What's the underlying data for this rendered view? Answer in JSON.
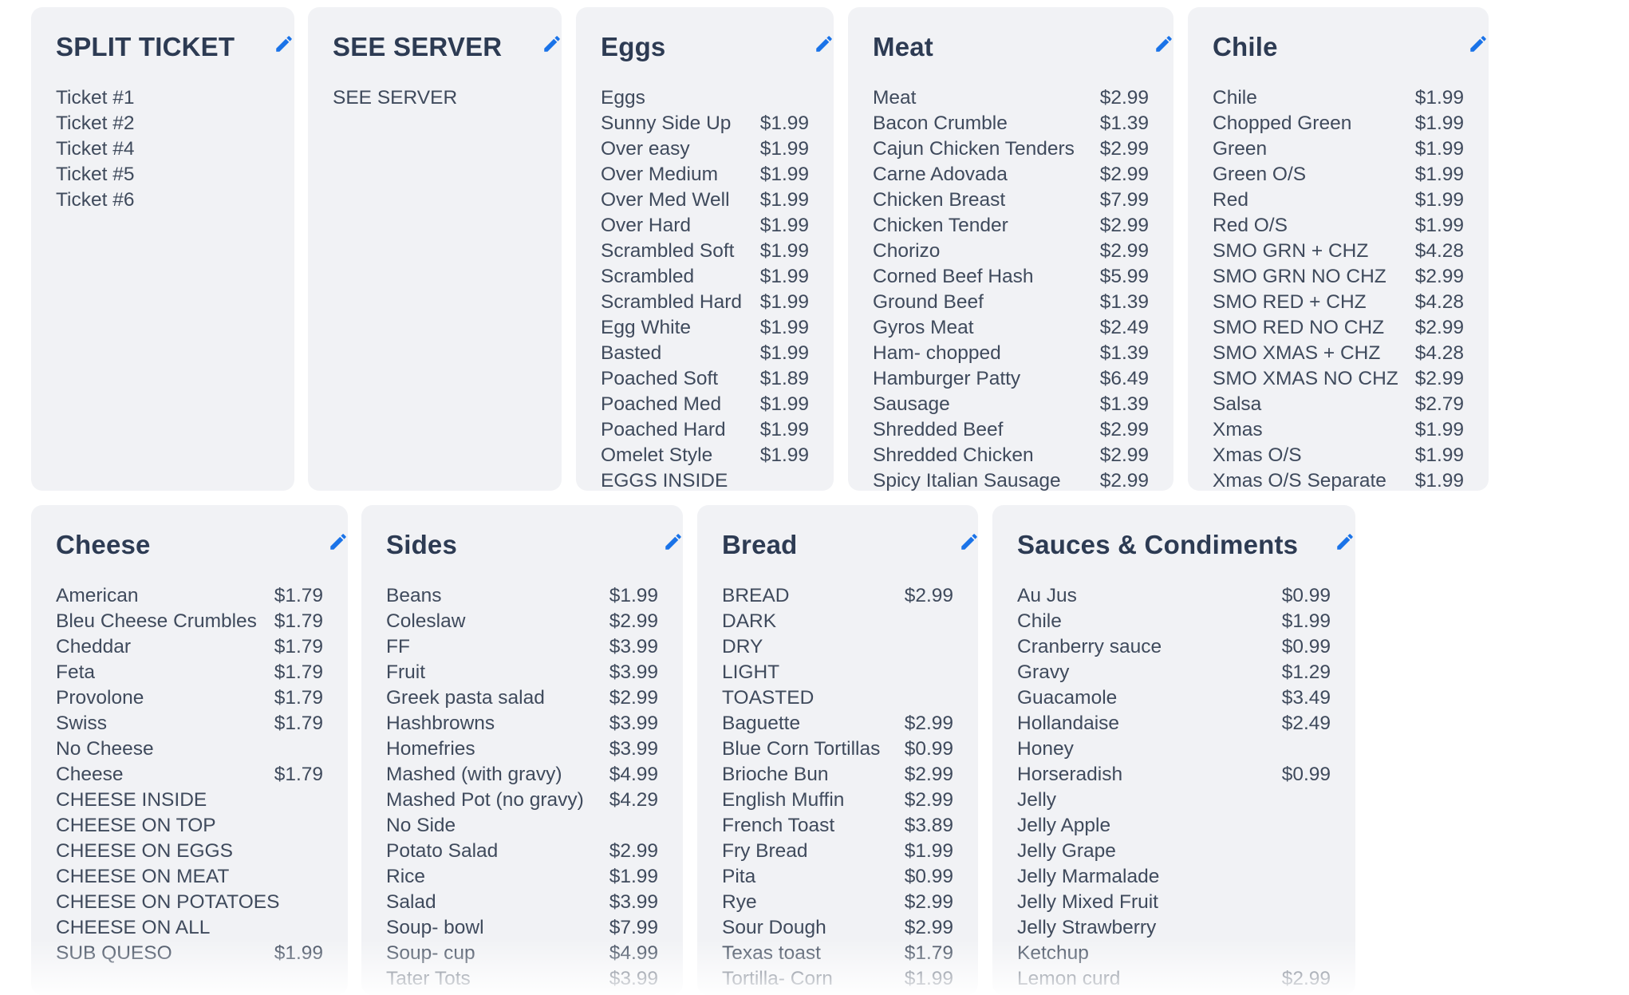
{
  "accent_color": "#1a73e8",
  "cards": [
    {
      "key": "split",
      "title": "SPLIT TICKET",
      "items": [
        {
          "n": "Ticket #1",
          "p": ""
        },
        {
          "n": "Ticket #2",
          "p": ""
        },
        {
          "n": "Ticket #4",
          "p": ""
        },
        {
          "n": "Ticket #5",
          "p": ""
        },
        {
          "n": "Ticket #6",
          "p": ""
        }
      ]
    },
    {
      "key": "server",
      "title": "SEE SERVER",
      "items": [
        {
          "n": "SEE SERVER",
          "p": ""
        }
      ]
    },
    {
      "key": "eggs",
      "title": "Eggs",
      "items": [
        {
          "n": "Eggs",
          "p": ""
        },
        {
          "n": "Sunny Side Up",
          "p": "$1.99"
        },
        {
          "n": "Over easy",
          "p": "$1.99"
        },
        {
          "n": "Over Medium",
          "p": "$1.99"
        },
        {
          "n": "Over Med Well",
          "p": "$1.99"
        },
        {
          "n": "Over Hard",
          "p": "$1.99"
        },
        {
          "n": "Scrambled Soft",
          "p": "$1.99"
        },
        {
          "n": "Scrambled",
          "p": "$1.99"
        },
        {
          "n": "Scrambled Hard",
          "p": "$1.99"
        },
        {
          "n": "Egg White",
          "p": "$1.99"
        },
        {
          "n": "Basted",
          "p": "$1.99"
        },
        {
          "n": "Poached Soft",
          "p": "$1.89"
        },
        {
          "n": "Poached Med",
          "p": "$1.99"
        },
        {
          "n": "Poached Hard",
          "p": "$1.99"
        },
        {
          "n": "Omelet Style",
          "p": "$1.99"
        },
        {
          "n": "EGGS INSIDE",
          "p": ""
        }
      ]
    },
    {
      "key": "meat",
      "title": "Meat",
      "items": [
        {
          "n": "Meat",
          "p": "$2.99"
        },
        {
          "n": "Bacon Crumble",
          "p": "$1.39"
        },
        {
          "n": "Cajun Chicken Tenders",
          "p": "$2.99"
        },
        {
          "n": "Carne Adovada",
          "p": "$2.99"
        },
        {
          "n": "Chicken Breast",
          "p": "$7.99"
        },
        {
          "n": "Chicken Tender",
          "p": "$2.99"
        },
        {
          "n": "Chorizo",
          "p": "$2.99"
        },
        {
          "n": "Corned Beef Hash",
          "p": "$5.99"
        },
        {
          "n": "Ground Beef",
          "p": "$1.39"
        },
        {
          "n": "Gyros Meat",
          "p": "$2.49"
        },
        {
          "n": "Ham- chopped",
          "p": "$1.39"
        },
        {
          "n": "Hamburger Patty",
          "p": "$6.49"
        },
        {
          "n": "Sausage",
          "p": "$1.39"
        },
        {
          "n": "Shredded Beef",
          "p": "$2.99"
        },
        {
          "n": "Shredded Chicken",
          "p": "$2.99"
        },
        {
          "n": "Spicy Italian Sausage",
          "p": "$2.99"
        }
      ]
    },
    {
      "key": "chile",
      "title": "Chile",
      "items": [
        {
          "n": "Chile",
          "p": "$1.99"
        },
        {
          "n": "Chopped Green",
          "p": "$1.99"
        },
        {
          "n": "Green",
          "p": "$1.99"
        },
        {
          "n": "Green O/S",
          "p": "$1.99"
        },
        {
          "n": "Red",
          "p": "$1.99"
        },
        {
          "n": "Red O/S",
          "p": "$1.99"
        },
        {
          "n": "SMO GRN + CHZ",
          "p": "$4.28"
        },
        {
          "n": "SMO GRN NO CHZ",
          "p": "$2.99"
        },
        {
          "n": "SMO RED + CHZ",
          "p": "$4.28"
        },
        {
          "n": "SMO RED NO CHZ",
          "p": "$2.99"
        },
        {
          "n": "SMO XMAS + CHZ",
          "p": "$4.28"
        },
        {
          "n": "SMO XMAS NO CHZ",
          "p": "$2.99"
        },
        {
          "n": "Salsa",
          "p": "$2.79"
        },
        {
          "n": "Xmas",
          "p": "$1.99"
        },
        {
          "n": "Xmas O/S",
          "p": "$1.99"
        },
        {
          "n": "Xmas O/S Separate",
          "p": "$1.99"
        }
      ]
    },
    {
      "key": "cheese",
      "title": "Cheese",
      "items": [
        {
          "n": "American",
          "p": "$1.79"
        },
        {
          "n": "Bleu Cheese Crumbles",
          "p": "$1.79"
        },
        {
          "n": "Cheddar",
          "p": "$1.79"
        },
        {
          "n": "Feta",
          "p": "$1.79"
        },
        {
          "n": "Provolone",
          "p": "$1.79"
        },
        {
          "n": "Swiss",
          "p": "$1.79"
        },
        {
          "n": "No Cheese",
          "p": ""
        },
        {
          "n": "Cheese",
          "p": "$1.79"
        },
        {
          "n": "CHEESE INSIDE",
          "p": ""
        },
        {
          "n": "CHEESE ON TOP",
          "p": ""
        },
        {
          "n": "CHEESE ON EGGS",
          "p": ""
        },
        {
          "n": "CHEESE ON MEAT",
          "p": ""
        },
        {
          "n": "CHEESE ON POTATOES",
          "p": ""
        },
        {
          "n": "CHEESE ON ALL",
          "p": ""
        },
        {
          "n": "SUB QUESO",
          "p": "$1.99"
        }
      ]
    },
    {
      "key": "sides",
      "title": "Sides",
      "items": [
        {
          "n": "Beans",
          "p": "$1.99"
        },
        {
          "n": "Coleslaw",
          "p": "$2.99"
        },
        {
          "n": "FF",
          "p": "$3.99"
        },
        {
          "n": "Fruit",
          "p": "$3.99"
        },
        {
          "n": "Greek pasta salad",
          "p": "$2.99"
        },
        {
          "n": "Hashbrowns",
          "p": "$3.99"
        },
        {
          "n": "Homefries",
          "p": "$3.99"
        },
        {
          "n": "Mashed (with gravy)",
          "p": "$4.99"
        },
        {
          "n": "Mashed Pot (no gravy)",
          "p": "$4.29"
        },
        {
          "n": "No Side",
          "p": ""
        },
        {
          "n": "Potato Salad",
          "p": "$2.99"
        },
        {
          "n": "Rice",
          "p": "$1.99"
        },
        {
          "n": "Salad",
          "p": "$3.99"
        },
        {
          "n": "Soup- bowl",
          "p": "$7.99"
        },
        {
          "n": "Soup- cup",
          "p": "$4.99"
        },
        {
          "n": "Tater Tots",
          "p": "$3.99"
        }
      ]
    },
    {
      "key": "bread",
      "title": "Bread",
      "items": [
        {
          "n": "BREAD",
          "p": "$2.99"
        },
        {
          "n": "DARK",
          "p": ""
        },
        {
          "n": "DRY",
          "p": ""
        },
        {
          "n": "LIGHT",
          "p": ""
        },
        {
          "n": "TOASTED",
          "p": ""
        },
        {
          "n": "Baguette",
          "p": "$2.99"
        },
        {
          "n": "Blue Corn Tortillas",
          "p": "$0.99"
        },
        {
          "n": "Brioche Bun",
          "p": "$2.99"
        },
        {
          "n": "English Muffin",
          "p": "$2.99"
        },
        {
          "n": "French Toast",
          "p": "$3.89"
        },
        {
          "n": "Fry Bread",
          "p": "$1.99"
        },
        {
          "n": "Pita",
          "p": "$0.99"
        },
        {
          "n": "Rye",
          "p": "$2.99"
        },
        {
          "n": "Sour Dough",
          "p": "$2.99"
        },
        {
          "n": "Texas toast",
          "p": "$1.79"
        },
        {
          "n": "Tortilla- Corn",
          "p": "$1.99"
        }
      ]
    },
    {
      "key": "sauces",
      "title": "Sauces & Condiments",
      "items": [
        {
          "n": "Au Jus",
          "p": "$0.99"
        },
        {
          "n": "Chile",
          "p": "$1.99"
        },
        {
          "n": "Cranberry sauce",
          "p": "$0.99"
        },
        {
          "n": "Gravy",
          "p": "$1.29"
        },
        {
          "n": "Guacamole",
          "p": "$3.49"
        },
        {
          "n": "Hollandaise",
          "p": "$2.49"
        },
        {
          "n": "Honey",
          "p": ""
        },
        {
          "n": "Horseradish",
          "p": "$0.99"
        },
        {
          "n": "Jelly",
          "p": ""
        },
        {
          "n": "Jelly Apple",
          "p": ""
        },
        {
          "n": "Jelly Grape",
          "p": ""
        },
        {
          "n": "Jelly Marmalade",
          "p": ""
        },
        {
          "n": "Jelly Mixed Fruit",
          "p": ""
        },
        {
          "n": "Jelly Strawberry",
          "p": ""
        },
        {
          "n": "Ketchup",
          "p": ""
        },
        {
          "n": "Lemon curd",
          "p": "$2.99"
        }
      ]
    }
  ]
}
